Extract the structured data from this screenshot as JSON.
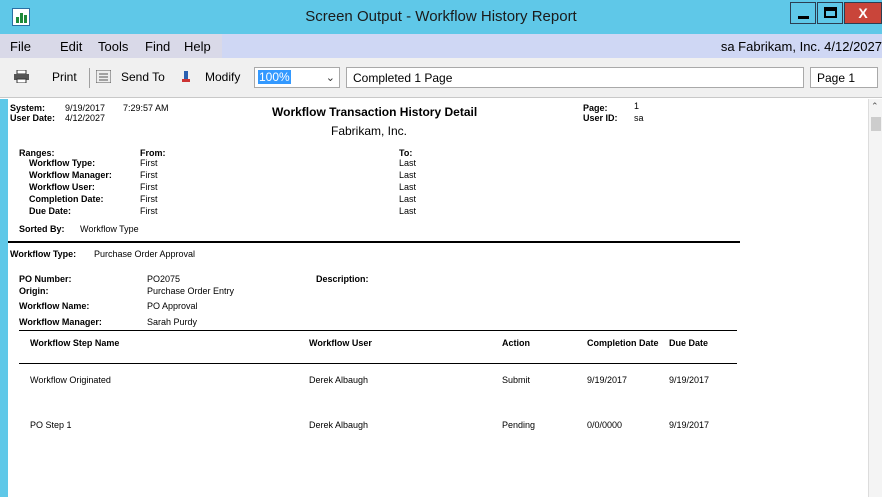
{
  "window": {
    "title": "Screen Output - Workflow History Report",
    "close_glyph": "X"
  },
  "menu": {
    "items": [
      "File",
      "Edit",
      "Tools",
      "Find",
      "Help"
    ],
    "right_text": "sa  Fabrikam, Inc.  4/12/2027"
  },
  "toolbar": {
    "print_label": "Print",
    "send_to_label": "Send To",
    "modify_label": "Modify",
    "zoom_value": "100%",
    "status_text": "Completed 1 Page",
    "page_text": "Page 1"
  },
  "report": {
    "system_label": "System:",
    "system_date": "9/19/2017",
    "system_time": "7:29:57 AM",
    "user_date_label": "User Date:",
    "user_date": "4/12/2027",
    "title": "Workflow Transaction History Detail",
    "company": "Fabrikam, Inc.",
    "page_label": "Page:",
    "page_value": "1",
    "user_id_label": "User ID:",
    "user_id_value": "sa",
    "ranges_label": "Ranges:",
    "from_label": "From:",
    "to_label": "To:",
    "ranges": [
      {
        "label": "Workflow Type:",
        "from": "First",
        "to": "Last"
      },
      {
        "label": "Workflow Manager:",
        "from": "First",
        "to": "Last"
      },
      {
        "label": "Workflow User:",
        "from": "First",
        "to": "Last"
      },
      {
        "label": "Completion Date:",
        "from": "First",
        "to": "Last"
      },
      {
        "label": "Due Date:",
        "from": "First",
        "to": "Last"
      }
    ],
    "sorted_by_label": "Sorted By:",
    "sorted_by_value": "Workflow Type",
    "workflow_type_label": "Workflow Type:",
    "workflow_type_value": "Purchase Order Approval",
    "po_number_label": "PO Number:",
    "po_number_value": "PO2075",
    "description_label": "Description:",
    "origin_label": "Origin:",
    "origin_value": "Purchase Order Entry",
    "workflow_name_label": "Workflow Name:",
    "workflow_name_value": "PO Approval",
    "workflow_manager_label": "Workflow Manager:",
    "workflow_manager_value": "Sarah Purdy",
    "columns": {
      "step": "Workflow Step Name",
      "user": "Workflow User",
      "action": "Action",
      "completion": "Completion Date",
      "due": "Due Date"
    },
    "rows": [
      {
        "step": "Workflow Originated",
        "user": "Derek Albaugh",
        "action": "Submit",
        "completion": "9/19/2017",
        "due": "9/19/2017"
      },
      {
        "step": "PO Step 1",
        "user": "Derek Albaugh",
        "action": "Pending",
        "completion": "0/0/0000",
        "due": "9/19/2017"
      }
    ]
  }
}
